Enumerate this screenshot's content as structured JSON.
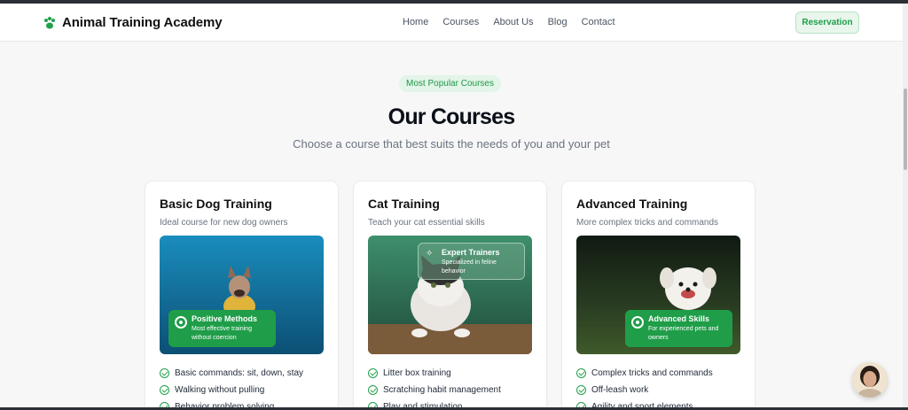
{
  "header": {
    "brand": "Animal Training Academy",
    "nav": [
      "Home",
      "Courses",
      "About Us",
      "Blog",
      "Contact"
    ],
    "reserve_label": "Reservation"
  },
  "hero": {
    "pill": "Most Popular Courses",
    "title": "Our Courses",
    "subtitle": "Choose a course that best suits the needs of you and your pet"
  },
  "courses": [
    {
      "title": "Basic Dog Training",
      "desc": "Ideal course for new dog owners",
      "badge_title": "Positive Methods",
      "badge_text_1": "Most effective training",
      "badge_text_2": "without coercion",
      "features": [
        "Basic commands: sit, down, stay",
        "Walking without pulling",
        "Behavior problem solving"
      ]
    },
    {
      "title": "Cat Training",
      "desc": "Teach your cat essential skills",
      "badge_title": "Expert Trainers",
      "badge_text_1": "Specialized in feline",
      "badge_text_2": "behavior",
      "features": [
        "Litter box training",
        "Scratching habit management",
        "Play and stimulation"
      ]
    },
    {
      "title": "Advanced Training",
      "desc": "More complex tricks and commands",
      "badge_title": "Advanced Skills",
      "badge_text_1": "For experienced pets and",
      "badge_text_2": "owners",
      "features": [
        "Complex tricks and commands",
        "Off-leash work",
        "Agility and sport elements"
      ]
    }
  ],
  "colors": {
    "accent": "#1f9d49",
    "pill_bg": "#e3f4e8"
  }
}
